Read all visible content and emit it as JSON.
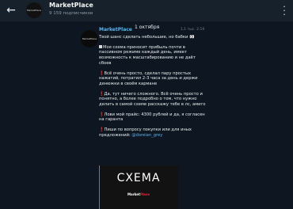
{
  "header": {
    "back_icon": "arrow-left-icon",
    "title": "MarketPlace",
    "subtitle": "9 159 подписчиков",
    "menu_icon": "more-vertical-icon"
  },
  "date_separator": "1 октября",
  "avatar_text": "MarketPlace",
  "message": {
    "sender": "MarketPlace",
    "views": "1,1 тыс. 2:19",
    "paragraphs": [
      "Твой шанс сделать небольшие, но бабки ",
      "Моя схема приносит прибыль почти в пассивном режиме каждый день, имеет возможность к масштабированию и не даёт сбоев",
      "Всё очень просто, сделал пару простых нажатий, потратил 2-3 часа за день и держи денюжки в своём кармане",
      "Да, тут ничего сложного. Всё очень просто и понятно, а более подробно о том, что нужно делать в самой схеме расскажу тебе в лс, амиго",
      "Лови мой прайс: 4300 рублей и да, я согласен на гаранта",
      "Пиши по вопросу покупки или для иных предложений: "
    ],
    "contact_link": "@doreian_grey",
    "media": {
      "title": "СХЕМА",
      "brand_main": "Market",
      "brand_accent": "Place"
    }
  },
  "colors": {
    "background": "#0e1621",
    "header": "#17212b",
    "link": "#5ab3f0",
    "accent_red": "#e0303b"
  }
}
